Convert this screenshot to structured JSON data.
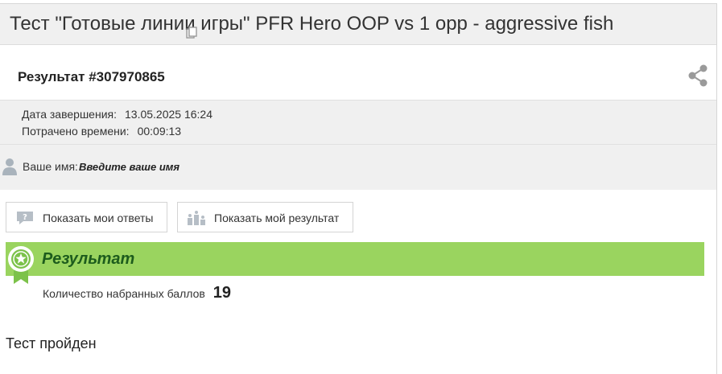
{
  "header": {
    "title": "Тест \"Готовые линии игры\" PFR Hero OOP vs 1 opp - aggressive fish"
  },
  "result": {
    "title": "Результат #307970865"
  },
  "meta": {
    "completed_label": "Дата завершения:",
    "completed_value": "13.05.2025 16:24",
    "spent_label": "Потрачено времени:",
    "spent_value": "00:09:13"
  },
  "name": {
    "label": "Ваше имя:",
    "placeholder": "Введите ваше имя"
  },
  "buttons": {
    "show_answers": "Показать мои ответы",
    "show_result": "Показать мой результат"
  },
  "banner": {
    "title": "Результат"
  },
  "score": {
    "label": "Количество набранных баллов",
    "value": "19"
  },
  "status": {
    "text": "Тест пройден"
  },
  "colors": {
    "banner": "#9ad45f",
    "banner_text": "#1d5c1d",
    "panel_bg": "#f0f0f0"
  },
  "icons": [
    "copy-icon",
    "share-icon",
    "user-icon",
    "question-bubble-icon",
    "podium-icon",
    "medal-icon"
  ]
}
